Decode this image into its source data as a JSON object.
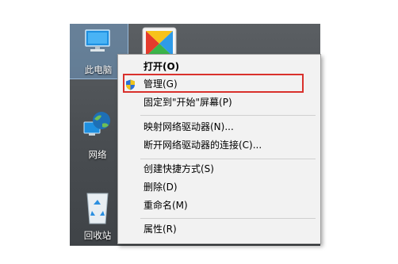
{
  "desktop": {
    "icons": [
      {
        "label": "此电脑",
        "icon": "computer-icon"
      },
      {
        "label": "网络",
        "icon": "network-globe-icon"
      },
      {
        "label": "回收站",
        "icon": "recycle-bin-icon"
      },
      {
        "label": "",
        "icon": "app-colorful-icon"
      }
    ]
  },
  "context_menu": {
    "items": [
      {
        "label": "打开(O)",
        "bold": true
      },
      {
        "label": "管理(G)",
        "icon": "uac-shield-icon",
        "highlighted": true
      },
      {
        "label": "固定到\"开始\"屏幕(P)"
      },
      {
        "label": "映射网络驱动器(N)..."
      },
      {
        "label": "断开网络驱动器的连接(C)..."
      },
      {
        "label": "创建快捷方式(S)"
      },
      {
        "label": "删除(D)"
      },
      {
        "label": "重命名(M)"
      },
      {
        "label": "属性(R)"
      }
    ]
  },
  "colors": {
    "highlight_border": "#d9312c",
    "menu_background": "#f2f2f2",
    "desktop_background": "#4a4e52"
  }
}
